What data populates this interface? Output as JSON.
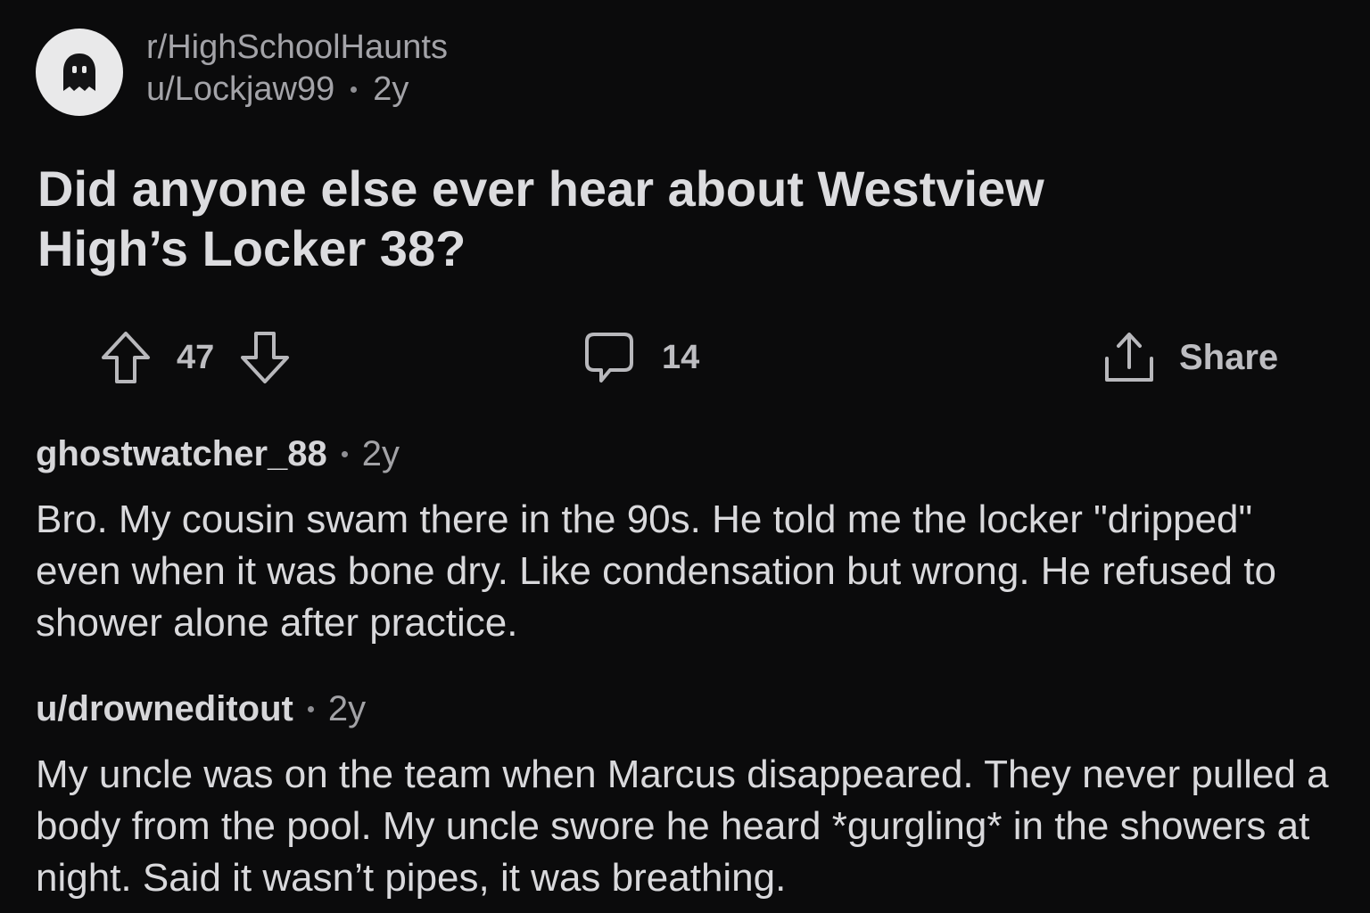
{
  "post": {
    "subreddit": "r/HighSchoolHaunts",
    "author": "u/Lockjaw99",
    "age": "2y",
    "avatar_icon": "ghost-icon",
    "title": "Did anyone else ever hear about Westview High’s Locker 38?"
  },
  "actions": {
    "upvote_icon": "arrow-up-icon",
    "vote_count": "47",
    "downvote_icon": "arrow-down-icon",
    "comment_icon": "speech-bubble-icon",
    "comment_count": "14",
    "share_icon": "share-upload-icon",
    "share_label": "Share"
  },
  "comments": [
    {
      "author": "ghostwatcher_88",
      "age": "2y",
      "body": "Bro. My cousin swam there in the 90s. He told me the locker \"dripped\" even when it was bone dry. Like condensation but wrong. He refused to shower alone after practice."
    },
    {
      "author": "u/drowneditout",
      "age": "2y",
      "body": "My uncle was on the team when Marcus disappeared. They never pulled a body from the pool. My uncle swore he heard *gurgling* in the showers at night. Said it wasn’t pipes, it was breathing."
    }
  ],
  "colors": {
    "background": "#0b0b0c",
    "text_primary": "#dcdcdf",
    "text_secondary": "#a3a3a8",
    "avatar_bg": "#e9e9ea"
  }
}
